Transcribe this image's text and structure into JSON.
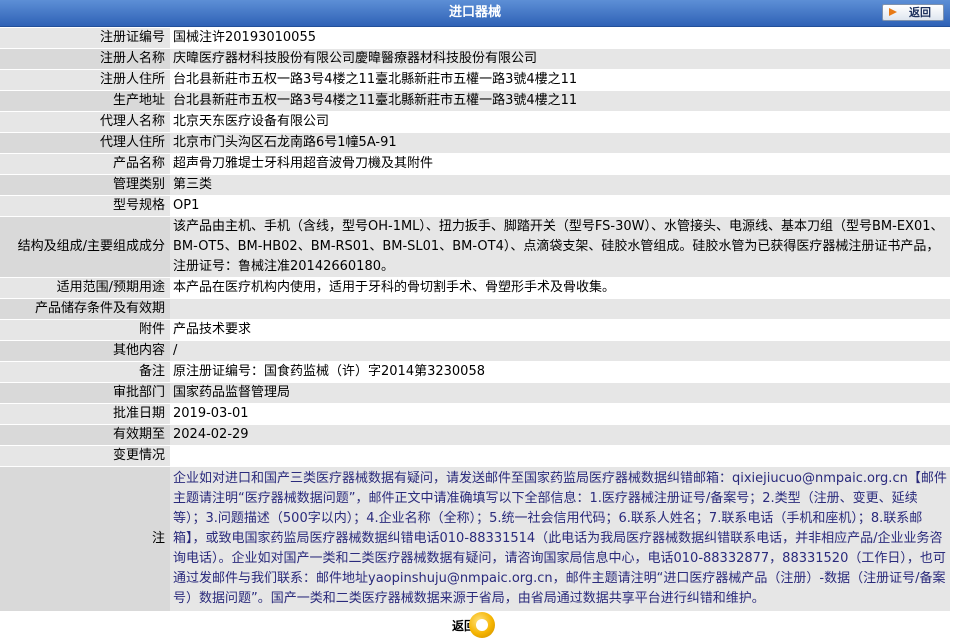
{
  "header": {
    "title": "进口器械",
    "back_label": "返回"
  },
  "fields": [
    {
      "label": "注册证编号",
      "value": "国械注许20193010055"
    },
    {
      "label": "注册人名称",
      "value": "庆暐医疗器材科技股份有限公司慶暐醫療器材科技股份有限公司"
    },
    {
      "label": "注册人住所",
      "value": "台北县新莊市五权一路3号4楼之11臺北縣新莊市五權一路3號4樓之11"
    },
    {
      "label": "生产地址",
      "value": "台北县新莊市五权一路3号4楼之11臺北縣新莊市五權一路3號4樓之11"
    },
    {
      "label": "代理人名称",
      "value": "北京天东医疗设备有限公司"
    },
    {
      "label": "代理人住所",
      "value": "北京市门头沟区石龙南路6号1幢5A-91"
    },
    {
      "label": "产品名称",
      "value": "超声骨刀雅堤士牙科用超音波骨刀機及其附件"
    },
    {
      "label": "管理类别",
      "value": "第三类"
    },
    {
      "label": "型号规格",
      "value": "OP1"
    },
    {
      "label": "结构及组成/主要组成成分",
      "value": "该产品由主机、手机（含线，型号OH-1ML）、扭力扳手、脚踏开关（型号FS-30W）、水管接头、电源线、基本刀组（型号BM-EX01、BM-OT5、BM-HB02、BM-RS01、BM-SL01、BM-OT4）、点滴袋支架、硅胶水管组成。硅胶水管为已获得医疗器械注册证书产品，注册证号：鲁械注准20142660180。"
    },
    {
      "label": "适用范围/预期用途",
      "value": "本产品在医疗机构内使用，适用于牙科的骨切割手术、骨塑形手术及骨收集。"
    },
    {
      "label": "产品储存条件及有效期",
      "value": ""
    },
    {
      "label": "附件",
      "value": "产品技术要求"
    },
    {
      "label": "其他内容",
      "value": "/"
    },
    {
      "label": "备注",
      "value": "原注册证编号：国食药监械（许）字2014第3230058"
    },
    {
      "label": "审批部门",
      "value": "国家药品监督管理局"
    },
    {
      "label": "批准日期",
      "value": "2019-03-01"
    },
    {
      "label": "有效期至",
      "value": "2024-02-29"
    },
    {
      "label": "变更情况",
      "value": ""
    }
  ],
  "note": {
    "label": "注",
    "text": "企业如对进口和国产三类医疗器械数据有疑问，请发送邮件至国家药监局医疗器械数据纠错邮箱：qixiejiucuo@nmpaic.org.cn【邮件主题请注明“医疗器械数据问题”，邮件正文中请准确填写以下全部信息：1.医疗器械注册证号/备案号；2.类型（注册、变更、延续等）；3.问题描述（500字以内）；4.企业名称（全称）；5.统一社会信用代码；6.联系人姓名；7.联系电话（手机和座机）；8.联系邮箱】，或致电国家药监局医疗器械数据纠错电话010-88331514（此电话为我局医疗器械数据纠错联系电话，并非相应产品/企业业务咨询电话）。企业如对国产一类和二类医疗器械数据有疑问，请咨询国家局信息中心，电话010-88332877，88331520（工作日），也可通过发邮件与我们联系：邮件地址yaopinshuju@nmpaic.org.cn，邮件主题请注明“进口医疗器械产品（注册）-数据（注册证号/备案号）数据问题”。国产一类和二类医疗器械数据来源于省局，由省局通过数据共享平台进行纠错和维护。"
  },
  "footer": {
    "back_label": "返回"
  }
}
